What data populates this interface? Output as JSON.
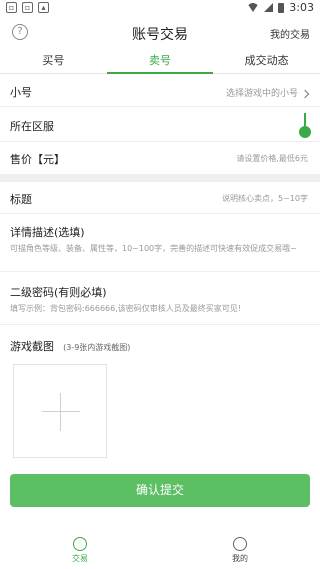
{
  "status": {
    "time": "3:03"
  },
  "header": {
    "title": "账号交易",
    "help_glyph": "?",
    "my_trades": "我的交易"
  },
  "tabs": [
    {
      "label": "买号"
    },
    {
      "label": "卖号",
      "active": true
    },
    {
      "label": "成交动态"
    }
  ],
  "form": {
    "account": {
      "label": "小号",
      "hint": "选择游戏中的小号"
    },
    "server": {
      "label": "所在区服"
    },
    "price": {
      "label": "售价【元】",
      "hint": "请设置价格,最低6元"
    },
    "title": {
      "label": "标题",
      "hint": "说明核心卖点，5~10字"
    },
    "details": {
      "label": "详情描述(选填)",
      "hint": "可描角色等级、装备、属性等，10~100字，完善的描述可快速有效促成交易哦~"
    },
    "password": {
      "label": "二级密码(有则必填)",
      "hint": "填写示例：背包密码:666666,该密码仅审核人员及最终买家可见!"
    },
    "screenshots": {
      "label": "游戏截图",
      "hint": "(3-9张内游戏截图)"
    }
  },
  "submit": {
    "label": "确认提交"
  },
  "nav": [
    {
      "label": "交易",
      "active": true
    },
    {
      "label": "我的"
    }
  ],
  "colors": {
    "accent": "#3aaa46",
    "button": "#5cbf64"
  }
}
